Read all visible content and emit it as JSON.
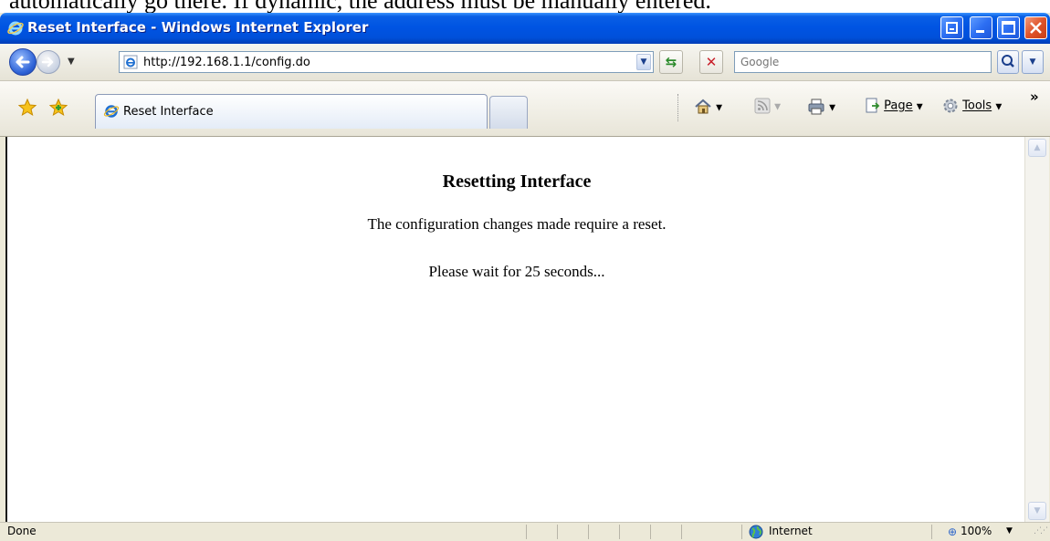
{
  "caption": "automatically go there. If dynamic, the address must be manually entered.",
  "window": {
    "title": "Reset Interface - Windows Internet Explorer"
  },
  "navbar": {
    "address": "http://192.168.1.1/config.do",
    "search_placeholder": "Google"
  },
  "tabs": [
    {
      "label": "Reset Interface"
    }
  ],
  "command_bar": {
    "page_label": "Page",
    "tools_label": "Tools"
  },
  "page": {
    "heading": "Resetting Interface",
    "message": "The configuration changes made require a reset.",
    "wait": "Please wait for 25 seconds..."
  },
  "status_bar": {
    "status": "Done",
    "zone": "Internet",
    "zoom": "100%"
  }
}
